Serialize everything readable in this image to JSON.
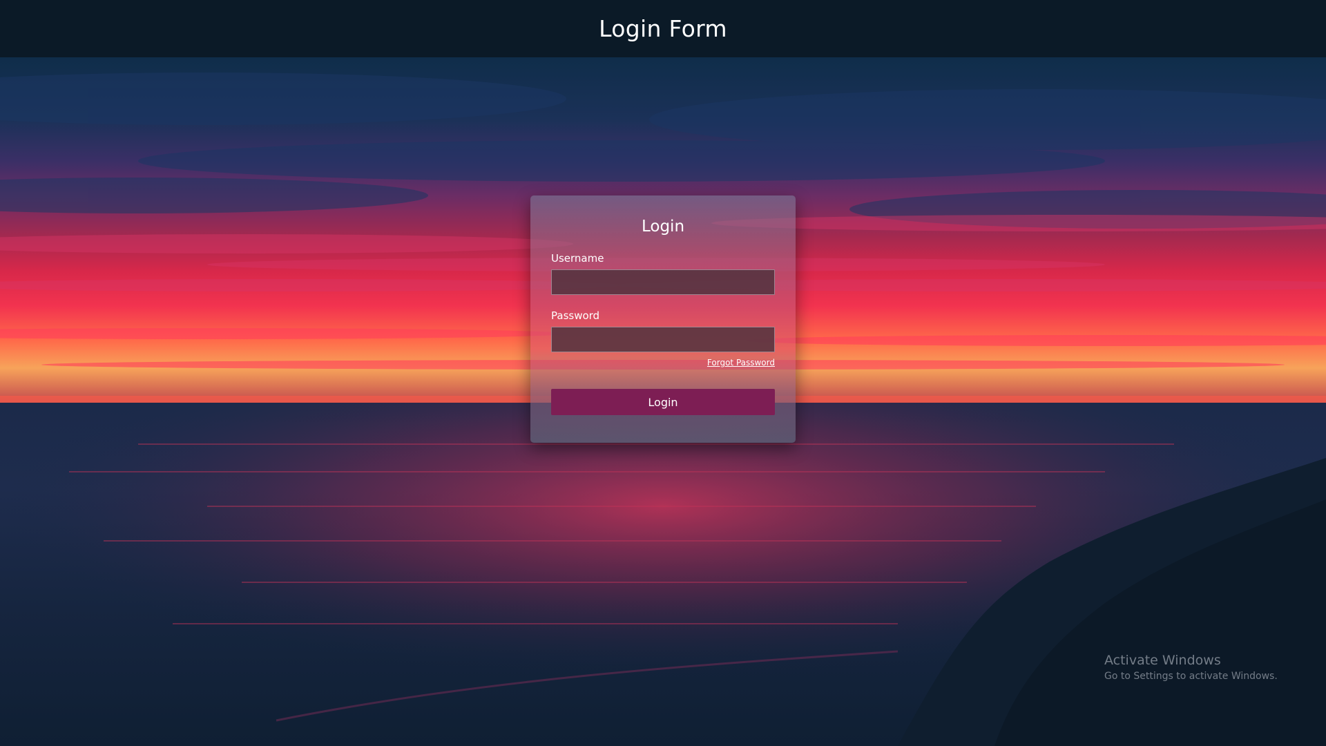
{
  "header": {
    "title": "Login Form"
  },
  "form": {
    "title": "Login",
    "username_label": "Username",
    "username_value": "",
    "password_label": "Password",
    "password_value": "",
    "forgot_password": "Forgot Password",
    "login_button": "Login"
  },
  "watermark": {
    "title": "Activate Windows",
    "subtitle": "Go to Settings to activate Windows."
  },
  "colors": {
    "topbar": "#0b1a27",
    "button": "#7d1e54",
    "sunset_red": "#e8284a",
    "ocean": "#132a45"
  }
}
